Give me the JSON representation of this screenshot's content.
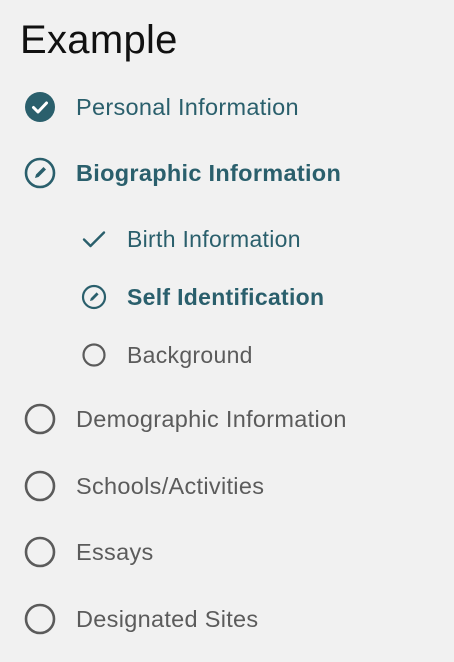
{
  "title": "Example",
  "colors": {
    "accent": "#2a5f6c",
    "muted": "#5b5b5b",
    "background": "#f1f1f1"
  },
  "steps": [
    {
      "label": "Personal Information",
      "status": "complete",
      "icon": "check-circle-filled-icon"
    },
    {
      "label": "Biographic Information",
      "status": "current",
      "icon": "pencil-circle-icon",
      "substeps": [
        {
          "label": "Birth Information",
          "status": "complete",
          "icon": "checkmark-icon"
        },
        {
          "label": "Self Identification",
          "status": "current",
          "icon": "pencil-circle-icon"
        },
        {
          "label": "Background",
          "status": "incomplete",
          "icon": "empty-circle-icon"
        }
      ]
    },
    {
      "label": "Demographic Information",
      "status": "incomplete",
      "icon": "empty-circle-icon"
    },
    {
      "label": "Schools/Activities",
      "status": "incomplete",
      "icon": "empty-circle-icon"
    },
    {
      "label": "Essays",
      "status": "incomplete",
      "icon": "empty-circle-icon"
    },
    {
      "label": "Designated Sites",
      "status": "incomplete",
      "icon": "empty-circle-icon"
    }
  ]
}
